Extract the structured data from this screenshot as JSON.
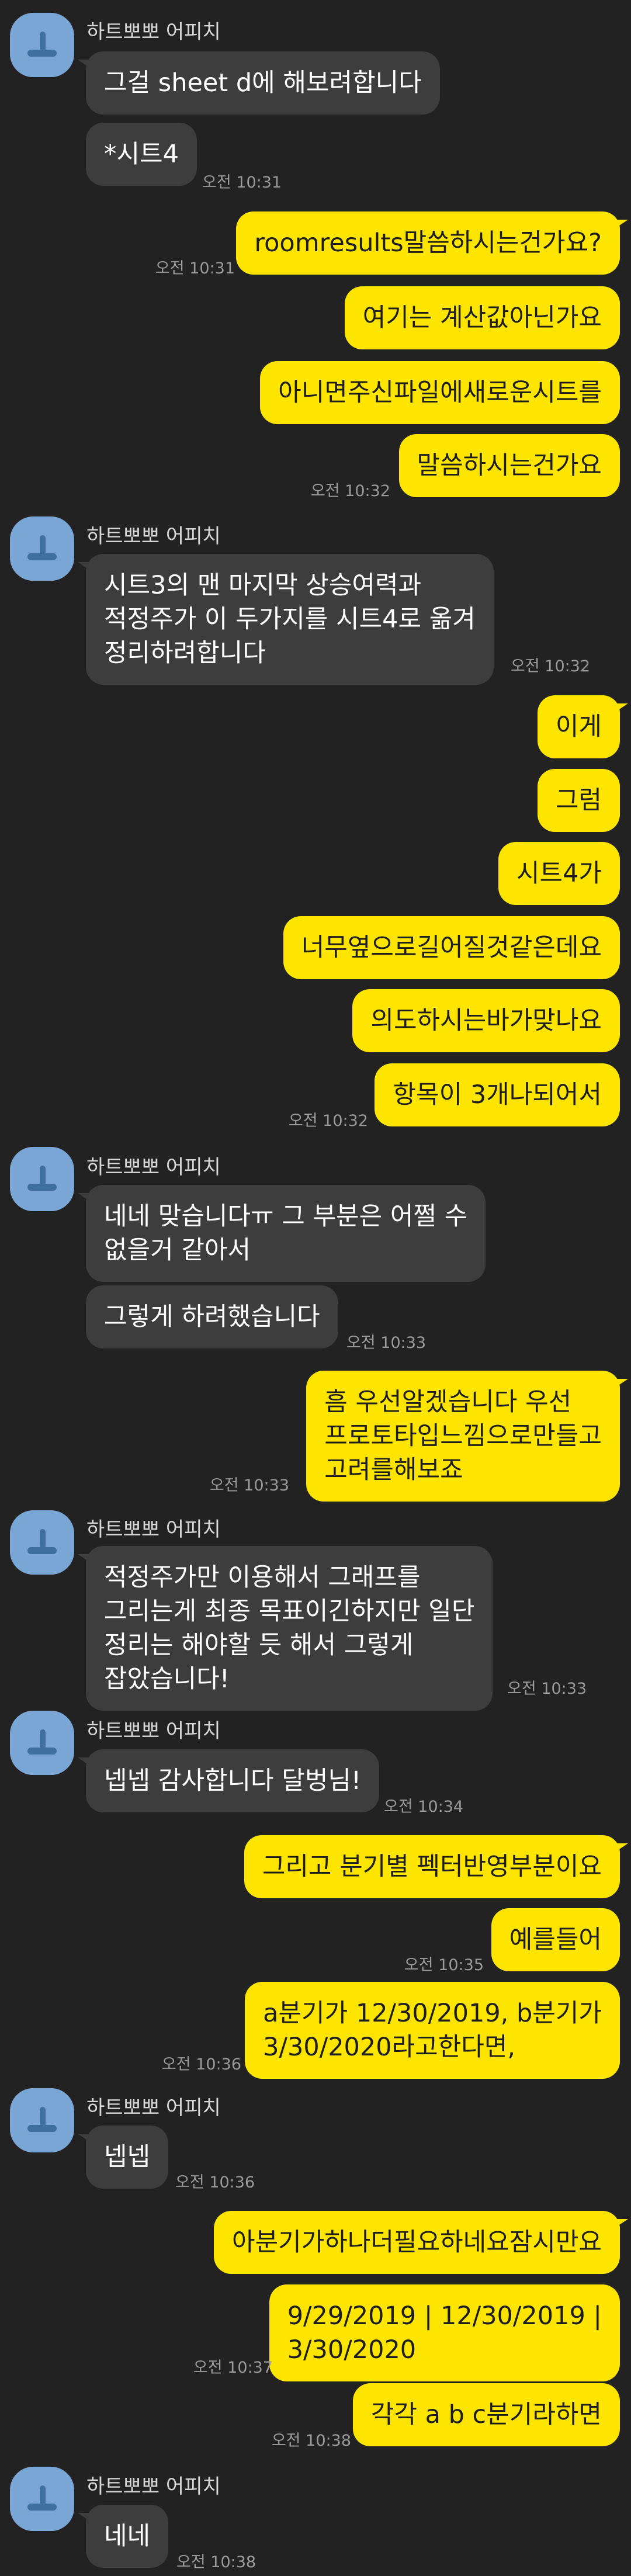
{
  "sender": {
    "name": "하트뽀뽀 어피치"
  },
  "messages": [
    {
      "id": "m1",
      "side": "in",
      "text": "그걸 sheet d에 해보려합니다"
    },
    {
      "id": "m2",
      "side": "in",
      "text": "*시트4",
      "time": "오전 10:31"
    },
    {
      "id": "m3",
      "side": "out",
      "text": "roomresults말씀하시는건가요?",
      "time": "오전 10:31"
    },
    {
      "id": "m4",
      "side": "out",
      "text": "여기는 계산값아닌가요"
    },
    {
      "id": "m5",
      "side": "out",
      "text": "아니면주신파일에새로운시트를"
    },
    {
      "id": "m6",
      "side": "out",
      "text": "말씀하시는건가요",
      "time": "오전 10:32"
    },
    {
      "id": "m7",
      "side": "in",
      "lines": [
        "시트3의 맨 마지막 상승여력과",
        "적정주가  이 두가지를 시트4로 옮겨",
        "정리하려합니다"
      ],
      "time": "오전 10:32"
    },
    {
      "id": "m8",
      "side": "out",
      "text": "이게"
    },
    {
      "id": "m9",
      "side": "out",
      "text": "그럼"
    },
    {
      "id": "m10",
      "side": "out",
      "text": "시트4가"
    },
    {
      "id": "m11",
      "side": "out",
      "text": "너무옆으로길어질것같은데요"
    },
    {
      "id": "m12",
      "side": "out",
      "text": "의도하시는바가맞나요"
    },
    {
      "id": "m13",
      "side": "out",
      "text": "항목이 3개나되어서",
      "time": "오전 10:32"
    },
    {
      "id": "m14",
      "side": "in",
      "lines": [
        "네네 맞습니다ㅠ 그 부분은 어쩔 수",
        "없을거 같아서"
      ]
    },
    {
      "id": "m15",
      "side": "in",
      "text": "그렇게 하려했습니다",
      "time": "오전 10:33"
    },
    {
      "id": "m16",
      "side": "out",
      "lines": [
        "흠 우선알겠습니다 우선",
        "프로토타입느낌으로만들고",
        "고려를해보죠"
      ],
      "time": "오전 10:33"
    },
    {
      "id": "m17",
      "side": "in",
      "lines": [
        "적정주가만 이용해서 그래프를",
        "그리는게 최종 목표이긴하지만 일단",
        "정리는 해야할 듯 해서 그렇게",
        "잡았습니다!"
      ],
      "time": "오전 10:33"
    },
    {
      "id": "m18",
      "side": "in",
      "text": "넵넵 감사합니다 달벙님!",
      "time": "오전 10:34"
    },
    {
      "id": "m19",
      "side": "out",
      "text": "그리고 분기별 펙터반영부분이요"
    },
    {
      "id": "m20",
      "side": "out",
      "text": "예를들어",
      "time": "오전 10:35"
    },
    {
      "id": "m21",
      "side": "out",
      "lines": [
        "a분기가 12/30/2019, b분기가",
        "3/30/2020라고한다면,"
      ],
      "time": "오전 10:36"
    },
    {
      "id": "m22",
      "side": "in",
      "text": "넵넵",
      "time": "오전 10:36"
    },
    {
      "id": "m23",
      "side": "out",
      "text": "아분기가하나더필요하네요잠시만요"
    },
    {
      "id": "m24",
      "side": "out",
      "lines": [
        "9/29/2019 | 12/30/2019 |",
        "3/30/2020"
      ],
      "time": "오전 10:37"
    },
    {
      "id": "m25",
      "side": "out",
      "text": "각각 a b c분기라하면",
      "time": "오전 10:38"
    },
    {
      "id": "m26",
      "side": "in",
      "text": "네네",
      "time": "오전 10:38"
    }
  ]
}
